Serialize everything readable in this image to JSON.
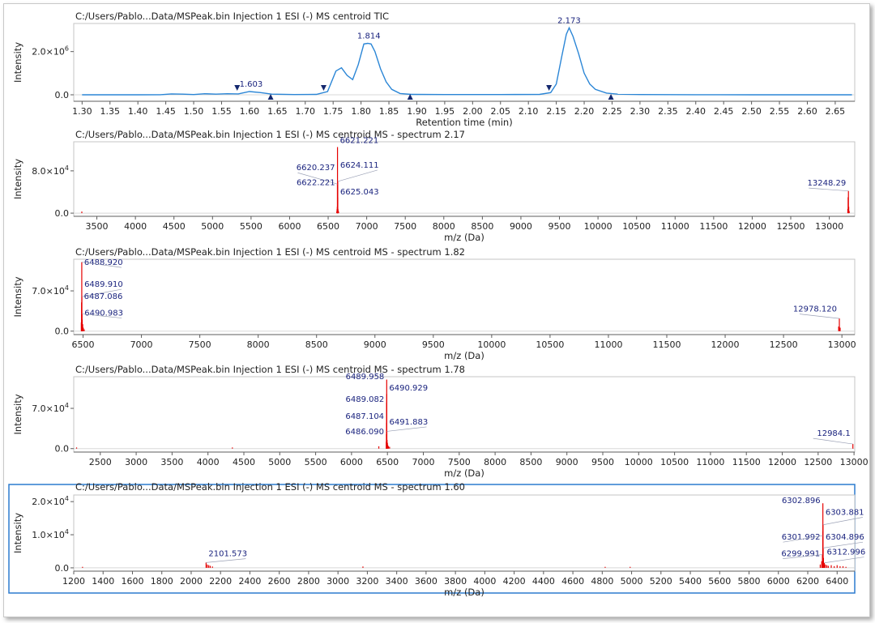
{
  "panels": [
    {
      "title": "C:/Users/Pablo...Data/MSPeak.bin Injection 1 ESI (-) MS centroid TIC",
      "ylabel": "Intensity",
      "xlabel": "Retention time (min)",
      "selected": false,
      "chart_data": {
        "type": "line",
        "x_range": [
          1.285,
          2.685
        ],
        "y_range": [
          -300000,
          3300000
        ],
        "x_ticks": [
          "1.30",
          "1.35",
          "1.40",
          "1.45",
          "1.50",
          "1.55",
          "1.60",
          "1.65",
          "1.70",
          "1.75",
          "1.80",
          "1.85",
          "1.90",
          "1.95",
          "2.00",
          "2.05",
          "2.10",
          "2.15",
          "2.20",
          "2.25",
          "2.30",
          "2.35",
          "2.40",
          "2.45",
          "2.50",
          "2.55",
          "2.60",
          "2.65"
        ],
        "y_ticks": [
          {
            "value": 0,
            "label": "0.0"
          },
          {
            "value": 2000000,
            "label": "2.0×10",
            "exp": "6"
          }
        ],
        "series": [
          {
            "color": "#2b86d6",
            "x": [
              1.3,
              1.35,
              1.4,
              1.44,
              1.46,
              1.48,
              1.5,
              1.52,
              1.54,
              1.56,
              1.58,
              1.6,
              1.62,
              1.64,
              1.68,
              1.72,
              1.74,
              1.755,
              1.765,
              1.775,
              1.785,
              1.795,
              1.805,
              1.812,
              1.818,
              1.825,
              1.835,
              1.845,
              1.855,
              1.87,
              1.89,
              1.95,
              2.05,
              2.12,
              2.14,
              2.15,
              2.16,
              2.168,
              2.173,
              2.18,
              2.19,
              2.2,
              2.21,
              2.22,
              2.24,
              2.26,
              2.3,
              2.4,
              2.5,
              2.6,
              2.68
            ],
            "y": [
              0,
              0,
              0,
              5000,
              40000,
              30000,
              10000,
              50000,
              30000,
              50000,
              40000,
              150000,
              100000,
              30000,
              10000,
              20000,
              150000,
              1100000,
              1250000,
              900000,
              700000,
              1400000,
              2350000,
              2380000,
              2350000,
              2000000,
              1200000,
              600000,
              250000,
              60000,
              20000,
              10000,
              10000,
              20000,
              100000,
              500000,
              1800000,
              2800000,
              3100000,
              2700000,
              1900000,
              1000000,
              500000,
              250000,
              80000,
              30000,
              10000,
              5000,
              0,
              0,
              0
            ]
          }
        ],
        "annotations": [
          {
            "x": 1.603,
            "y": 150000,
            "label": "1.603"
          },
          {
            "x": 1.814,
            "y": 2380000,
            "label": "1.814"
          },
          {
            "x": 2.173,
            "y": 3100000,
            "label": "2.173"
          }
        ],
        "markers": [
          {
            "x": 1.578,
            "y": 150000,
            "dir": "down"
          },
          {
            "x": 1.638,
            "y": 0,
            "dir": "up"
          },
          {
            "x": 1.733,
            "y": 150000,
            "dir": "down"
          },
          {
            "x": 1.888,
            "y": 0,
            "dir": "up"
          },
          {
            "x": 2.137,
            "y": 150000,
            "dir": "down"
          },
          {
            "x": 2.248,
            "y": 0,
            "dir": "up"
          }
        ]
      }
    },
    {
      "title": "C:/Users/Pablo...Data/MSPeak.bin Injection 1 ESI (-) MS centroid MS - spectrum 2.17",
      "ylabel": "Intensity",
      "xlabel": "m/z (Da)",
      "selected": false,
      "chart_data": {
        "type": "bar",
        "x_range": [
          3200,
          13330
        ],
        "y_range": [
          -6000,
          135000
        ],
        "x_ticks": [
          "3500",
          "4000",
          "4500",
          "5000",
          "5500",
          "6000",
          "6500",
          "7000",
          "7500",
          "8000",
          "8500",
          "9000",
          "9500",
          "10000",
          "10500",
          "11000",
          "11500",
          "12000",
          "12500",
          "13000"
        ],
        "y_ticks": [
          {
            "value": 0,
            "label": "0.0"
          },
          {
            "value": 80000,
            "label": "8.0×10",
            "exp": "4"
          }
        ],
        "peaks": [
          [
            3305,
            3000
          ],
          [
            6612,
            3000
          ],
          [
            6615,
            6000
          ],
          [
            6617,
            8000
          ],
          [
            6619,
            12000
          ],
          [
            6620.237,
            55000
          ],
          [
            6621.221,
            125000
          ],
          [
            6622.221,
            50000
          ],
          [
            6623,
            30000
          ],
          [
            6624.111,
            60000
          ],
          [
            6625.043,
            30000
          ],
          [
            6627,
            8000
          ],
          [
            6630,
            5000
          ],
          [
            6635,
            3000
          ],
          [
            13240,
            8000
          ],
          [
            13244,
            30000
          ],
          [
            13248.29,
            42000
          ],
          [
            13252,
            12000
          ],
          [
            13258,
            4000
          ]
        ],
        "annotations": [
          {
            "x": 6621.221,
            "y": 125000,
            "label": "6621.221",
            "side": "right",
            "ty": 133000
          },
          {
            "x": 6620.237,
            "y": 55000,
            "label": "6620.237",
            "side": "left",
            "ty": 81000
          },
          {
            "x": 6624.111,
            "y": 60000,
            "label": "6624.111",
            "side": "right",
            "ty": 86000
          },
          {
            "x": 6622.221,
            "y": 50000,
            "label": "6622.221",
            "side": "left",
            "ty": 53000
          },
          {
            "x": 6625.043,
            "y": 30000,
            "label": "6625.043",
            "side": "right",
            "ty": 35000
          },
          {
            "x": 13248.29,
            "y": 42000,
            "label": "13248.29",
            "side": "left",
            "ty": 52000
          }
        ]
      }
    },
    {
      "title": "C:/Users/Pablo...Data/MSPeak.bin Injection 1 ESI (-) MS centroid MS - spectrum 1.82",
      "ylabel": "Intensity",
      "xlabel": "m/z (Da)",
      "selected": false,
      "chart_data": {
        "type": "bar",
        "x_range": [
          6420,
          13110
        ],
        "y_range": [
          -6000,
          125000
        ],
        "x_ticks": [
          "6500",
          "7000",
          "7500",
          "8000",
          "8500",
          "9000",
          "9500",
          "10000",
          "10500",
          "11000",
          "11500",
          "12000",
          "12500",
          "13000"
        ],
        "y_ticks": [
          {
            "value": 0,
            "label": "0.0"
          },
          {
            "value": 70000,
            "label": "7.0×10",
            "exp": "4"
          }
        ],
        "peaks": [
          [
            6485,
            15000
          ],
          [
            6487.086,
            50000
          ],
          [
            6488.92,
            120000
          ],
          [
            6489.91,
            60000
          ],
          [
            6490.983,
            30000
          ],
          [
            6493,
            20000
          ],
          [
            6497,
            12000
          ],
          [
            6502,
            6000
          ],
          [
            6510,
            3000
          ],
          [
            12972,
            8000
          ],
          [
            12978.12,
            22000
          ],
          [
            12985,
            6000
          ]
        ],
        "annotations": [
          {
            "x": 6488.92,
            "y": 120000,
            "label": "6488.920",
            "side": "right",
            "ty": 115000
          },
          {
            "x": 6489.91,
            "y": 60000,
            "label": "6489.910",
            "side": "right",
            "ty": 77000
          },
          {
            "x": 6487.086,
            "y": 50000,
            "label": "6487.086",
            "side": "right",
            "ty": 56000
          },
          {
            "x": 6490.983,
            "y": 30000,
            "label": "6490.983",
            "side": "right",
            "ty": 27000
          },
          {
            "x": 12978.12,
            "y": 22000,
            "label": "12978.120",
            "side": "left",
            "ty": 34000
          }
        ]
      }
    },
    {
      "title": "C:/Users/Pablo...Data/MSPeak.bin Injection 1 ESI (-) MS centroid MS - spectrum 1.78",
      "ylabel": "Intensity",
      "xlabel": "m/z (Da)",
      "selected": false,
      "chart_data": {
        "type": "bar",
        "x_range": [
          2130,
          13010
        ],
        "y_range": [
          -6000,
          125000
        ],
        "x_ticks": [
          "2500",
          "3000",
          "3500",
          "4000",
          "4500",
          "5000",
          "5500",
          "6000",
          "6500",
          "7000",
          "7500",
          "8000",
          "8500",
          "9000",
          "9500",
          "10000",
          "10500",
          "11000",
          "11500",
          "12000",
          "12500",
          "13000"
        ],
        "y_ticks": [
          {
            "value": 0,
            "label": "0.0"
          },
          {
            "value": 70000,
            "label": "7.0×10",
            "exp": "4"
          }
        ],
        "peaks": [
          [
            2170,
            2000
          ],
          [
            4340,
            2000
          ],
          [
            6380,
            4000
          ],
          [
            6484,
            12000
          ],
          [
            6486.09,
            25000
          ],
          [
            6487.104,
            45000
          ],
          [
            6489.082,
            80000
          ],
          [
            6489.958,
            120000
          ],
          [
            6490.929,
            95000
          ],
          [
            6491.883,
            30000
          ],
          [
            6495,
            15000
          ],
          [
            6500,
            10000
          ],
          [
            6506,
            6000
          ],
          [
            6515,
            4000
          ],
          [
            6530,
            3000
          ],
          [
            12984.1,
            8000
          ]
        ],
        "annotations": [
          {
            "x": 6489.958,
            "y": 120000,
            "label": "6489.958",
            "side": "left",
            "ty": 121000
          },
          {
            "x": 6490.929,
            "y": 95000,
            "label": "6490.929",
            "side": "right",
            "ty": 101000
          },
          {
            "x": 6489.082,
            "y": 80000,
            "label": "6489.082",
            "side": "left",
            "ty": 81000
          },
          {
            "x": 6487.104,
            "y": 45000,
            "label": "6487.104",
            "side": "left",
            "ty": 52000
          },
          {
            "x": 6491.883,
            "y": 30000,
            "label": "6491.883",
            "side": "right",
            "ty": 42000
          },
          {
            "x": 6486.09,
            "y": 25000,
            "label": "6486.090",
            "side": "left",
            "ty": 25000
          },
          {
            "x": 12984.1,
            "y": 8000,
            "label": "12984.1",
            "side": "left",
            "ty": 22000
          }
        ]
      }
    },
    {
      "title": "C:/Users/Pablo...Data/MSPeak.bin Injection 1 ESI (-) MS centroid MS - spectrum 1.60",
      "ylabel": "Intensity",
      "xlabel": "m/z (Da)",
      "selected": true,
      "chart_data": {
        "type": "bar",
        "x_range": [
          1200,
          6520
        ],
        "y_range": [
          -1000,
          22000
        ],
        "x_ticks": [
          "1200",
          "1400",
          "1600",
          "1800",
          "2000",
          "2200",
          "2400",
          "2600",
          "2800",
          "3000",
          "3200",
          "3400",
          "3600",
          "3800",
          "4000",
          "4200",
          "4400",
          "4600",
          "4800",
          "5000",
          "5200",
          "5400",
          "5600",
          "5800",
          "6000",
          "6200",
          "6400"
        ],
        "y_ticks": [
          {
            "value": 0,
            "label": "0.0"
          },
          {
            "value": 10000,
            "label": "1.0×10",
            "exp": "4"
          },
          {
            "value": 20000,
            "label": "2.0×10",
            "exp": "4"
          }
        ],
        "peaks": [
          [
            1260,
            300
          ],
          [
            2101.573,
            1600
          ],
          [
            2110,
            1000
          ],
          [
            2120,
            800
          ],
          [
            2130,
            600
          ],
          [
            2145,
            400
          ],
          [
            3170,
            400
          ],
          [
            4820,
            300
          ],
          [
            4990,
            300
          ],
          [
            6285,
            1000
          ],
          [
            6295,
            2000
          ],
          [
            6299.991,
            4000
          ],
          [
            6301.992,
            11000
          ],
          [
            6302.896,
            19500
          ],
          [
            6303.881,
            13000
          ],
          [
            6304.896,
            6000
          ],
          [
            6307,
            3000
          ],
          [
            6312.996,
            1500
          ],
          [
            6320,
            1000
          ],
          [
            6330,
            800
          ],
          [
            6340,
            600
          ],
          [
            6360,
            800
          ],
          [
            6380,
            500
          ],
          [
            6400,
            800
          ],
          [
            6420,
            500
          ],
          [
            6440,
            500
          ],
          [
            6460,
            300
          ]
        ],
        "annotations": [
          {
            "x": 2101.573,
            "y": 1600,
            "label": "2101.573",
            "side": "right",
            "ty": 3500
          },
          {
            "x": 6302.896,
            "y": 19500,
            "label": "6302.896",
            "side": "left",
            "ty": 19500
          },
          {
            "x": 6303.881,
            "y": 13000,
            "label": "6303.881",
            "side": "right",
            "ty": 16000
          },
          {
            "x": 6301.992,
            "y": 11000,
            "label": "6301.992",
            "side": "left",
            "ty": 8500
          },
          {
            "x": 6304.896,
            "y": 6000,
            "label": "6304.896",
            "side": "right",
            "ty": 8500
          },
          {
            "x": 6299.991,
            "y": 4000,
            "label": "6299.991",
            "side": "left",
            "ty": 3500
          },
          {
            "x": 6312.996,
            "y": 1500,
            "label": "6312.996",
            "side": "right",
            "ty": 4000
          }
        ]
      }
    }
  ],
  "colors": {
    "tic_line": "#2b86d6",
    "peak": "#e60000",
    "label_text": "#1a237e",
    "axis": "#5c5c5c",
    "gridline": "#d8d8d8",
    "marker": "#14286e",
    "selection_border": "#2c7bcf"
  }
}
